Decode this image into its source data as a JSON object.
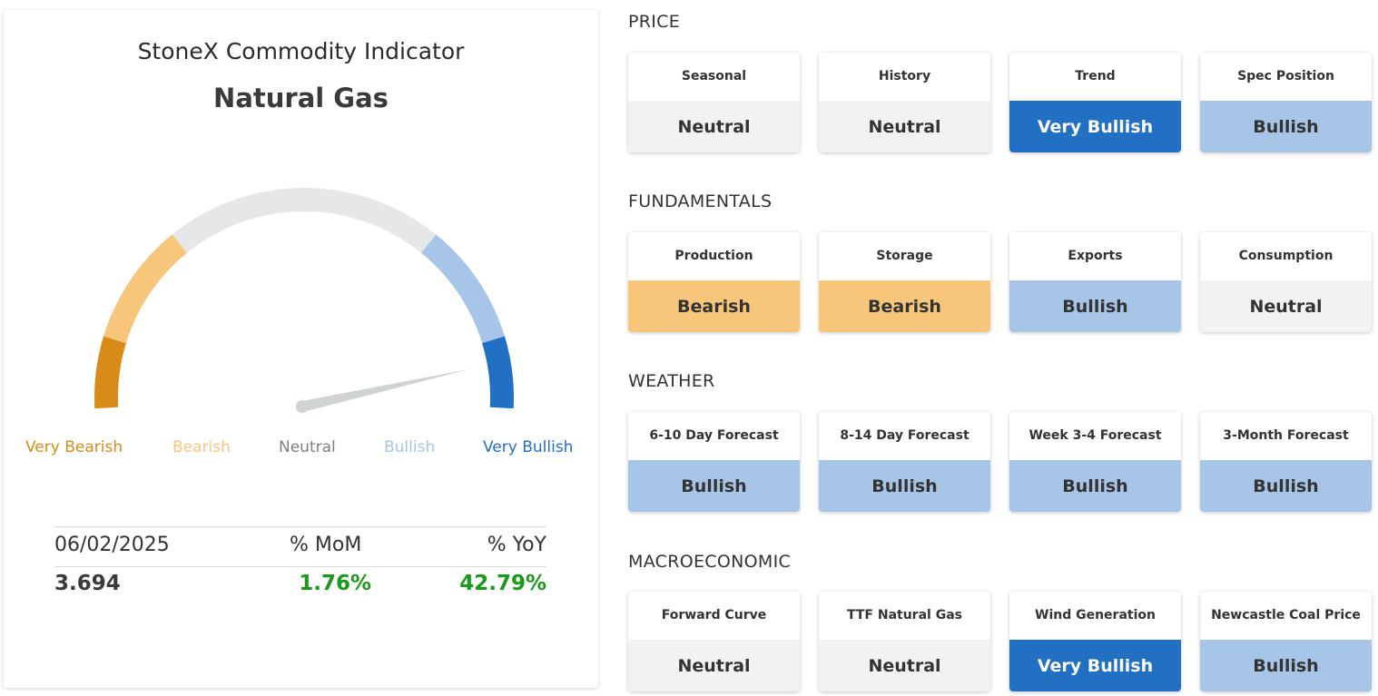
{
  "indicator": {
    "title": "StoneX Commodity Indicator",
    "commodity": "Natural Gas",
    "gauge": {
      "labels": [
        {
          "text": "Very Bearish",
          "color": "#d98b1a"
        },
        {
          "text": "Bearish",
          "color": "#f7c67a"
        },
        {
          "text": "Neutral",
          "color": "#808080"
        },
        {
          "text": "Bullish",
          "color": "#a7c5e7"
        },
        {
          "text": "Very Bullish",
          "color": "#2170c4"
        }
      ],
      "needle_value": 0.93
    },
    "stats": {
      "date": "06/02/2025",
      "mom_label": "% MoM",
      "yoy_label": "% YoY",
      "price": "3.694",
      "mom": "1.76%",
      "yoy": "42.79%",
      "positive_color": "#1a9a1a"
    }
  },
  "sections": [
    {
      "title": "PRICE",
      "tiles": [
        {
          "label": "Seasonal",
          "value": "Neutral",
          "level": "neutral"
        },
        {
          "label": "History",
          "value": "Neutral",
          "level": "neutral"
        },
        {
          "label": "Trend",
          "value": "Very Bullish",
          "level": "verybullish"
        },
        {
          "label": "Spec Position",
          "value": "Bullish",
          "level": "bullish"
        }
      ]
    },
    {
      "title": "FUNDAMENTALS",
      "tiles": [
        {
          "label": "Production",
          "value": "Bearish",
          "level": "bearish"
        },
        {
          "label": "Storage",
          "value": "Bearish",
          "level": "bearish"
        },
        {
          "label": "Exports",
          "value": "Bullish",
          "level": "bullish"
        },
        {
          "label": "Consumption",
          "value": "Neutral",
          "level": "neutral"
        }
      ]
    },
    {
      "title": "WEATHER",
      "tiles": [
        {
          "label": "6-10 Day Forecast",
          "value": "Bullish",
          "level": "bullish"
        },
        {
          "label": "8-14 Day Forecast",
          "value": "Bullish",
          "level": "bullish"
        },
        {
          "label": "Week 3-4 Forecast",
          "value": "Bullish",
          "level": "bullish"
        },
        {
          "label": "3-Month Forecast",
          "value": "Bullish",
          "level": "bullish"
        }
      ]
    },
    {
      "title": "MACROECONOMIC",
      "tiles": [
        {
          "label": "Forward Curve",
          "value": "Neutral",
          "level": "neutral"
        },
        {
          "label": "TTF Natural Gas",
          "value": "Neutral",
          "level": "neutral"
        },
        {
          "label": "Wind Generation",
          "value": "Very Bullish",
          "level": "verybullish"
        },
        {
          "label": "Newcastle Coal Price",
          "value": "Bullish",
          "level": "bullish"
        }
      ]
    }
  ],
  "colors": {
    "very_bearish": "#d98b1a",
    "bearish": "#f7c67a",
    "neutral": "#e6e8e8",
    "bullish": "#a7c5e7",
    "very_bullish": "#2170c4",
    "needle": "#cfd3d3"
  }
}
